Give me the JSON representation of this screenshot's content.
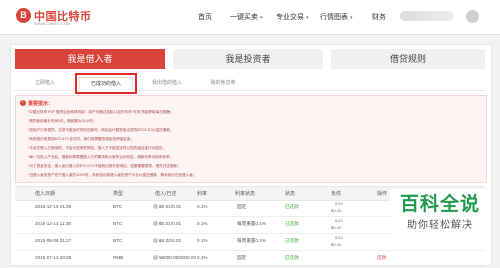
{
  "header": {
    "logo_mark": "B",
    "logo_text": "中国比特币",
    "logo_sub": "WWW.CHBTC.COM",
    "nav": [
      {
        "label": "首页",
        "has_caret": false
      },
      {
        "label": "一键买卖",
        "has_caret": true
      },
      {
        "label": "专业交易",
        "has_caret": true
      },
      {
        "label": "行情图表",
        "has_caret": true
      },
      {
        "label": "财务",
        "has_caret": false
      }
    ],
    "caret_glyph": "▾"
  },
  "role_tabs": [
    "我是借入者",
    "我是投资者",
    "借贷规则"
  ],
  "sub_tabs": [
    "立即借入",
    "已成功的借入",
    "我出借的借入",
    "我的免息券"
  ],
  "notice": {
    "icon": "!",
    "title": "重要提示：",
    "lines": [
      "“中国比特币 P2P 借贷包含两项机制：用户可通过发起12加的币币“可用”资金获取每日报酬；",
      "“借贷使用最长时间5天，借款期为24小时；",
      "*如用户已有借贷，当您不能及时完成还款时，网站会代替您卖出您的BTC/LTC以偿还借款；",
      "*系统按日收费到BTC/LTC仓位时，我们将提醒您增加抵押保证金；",
      "*平台在借入方使用前，不会为您承担风险，借入方不能偿还时以您的保证金代为偿还；",
      "*每一位投入产业后，借款利率根据借入方的需求和大家的议价而定，借款利率可用来参考；",
      "*为了资金安全，借入者已借入的BTC/LTC不能转出到外部地址，如果需要提现，请先归还借款；",
      "*当借入者的资产低于借入量的110%时，系统自动将借入者的资产平仓以偿还借款，剩余部分归还借入者。"
    ]
  },
  "table": {
    "headers": [
      "借入日期",
      "类型",
      "借入/已还",
      "利率",
      "利率状态",
      "状态",
      "负债",
      "操作"
    ],
    "rows": [
      {
        "date": "2015-12-19 21:36",
        "type": "BTC",
        "amount": "฿0.01/0.01",
        "rate": "0.1%",
        "rate_status": "固定",
        "status": "已还款",
        "debt_top": "0/10",
        "debt_bottom": "฿0.00",
        "op": ""
      },
      {
        "date": "2015-12-14 11:38",
        "type": "BTC",
        "amount": "฿0.01/0.01",
        "rate": "0.1%",
        "rate_status": "每周重置0.1%",
        "status": "已还款",
        "debt_top": "0/10",
        "debt_bottom": "฿0.00",
        "op": ""
      },
      {
        "date": "2015-09-06 21:27",
        "type": "BTC",
        "amount": "฿4.02/4.02",
        "rate": "0.1%",
        "rate_status": "每周重置0.1%",
        "status": "已还款",
        "debt_top": "0/10",
        "debt_bottom": "฿0.00",
        "op": ""
      },
      {
        "date": "2015-07-13 20:39",
        "type": "RMB",
        "amount": "¥6000.00/6000.00",
        "rate": "0.1%",
        "rate_status": "固定",
        "status": "已还款",
        "debt_top": "",
        "debt_bottom": "",
        "op": "还款"
      }
    ]
  },
  "watermark": {
    "title": "百科全说",
    "subtitle": "助你轻松解决"
  }
}
